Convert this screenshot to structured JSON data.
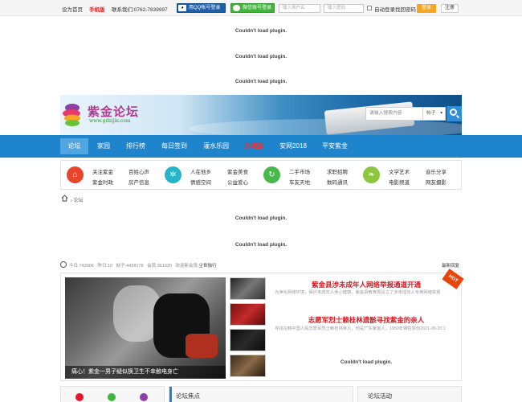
{
  "topbar": {
    "set_home": "设为首页",
    "mobile": "手机版",
    "contact": "联系我们:0762-7839997",
    "qq_login": "用QQ帐号登录",
    "wechat_login": "微信账号登录",
    "username_placeholder": "输入用户名",
    "password_placeholder": "输入密码",
    "auto_login": "自动登录",
    "forgot": "找回密码",
    "login": "登录",
    "register": "注册"
  },
  "plugin_message": "Couldn't load plugin.",
  "logo": {
    "name": "紫金论坛",
    "url": "www.gdzijin.com"
  },
  "search": {
    "placeholder": "请输入搜索内容",
    "scope": "帖子"
  },
  "nav": [
    "论坛",
    "家园",
    "排行榜",
    "每日签到",
    "灌水乐园",
    "手机版",
    "安网2018",
    "平安紫金"
  ],
  "categories": {
    "group1": [
      "关注紫金",
      "百姓心声",
      "紫金时政",
      "房产信息"
    ],
    "group2": [
      "人在他乡",
      "紫金美食",
      "情感空间",
      "公益爱心"
    ],
    "group3": [
      "二手市场",
      "求职招聘",
      "车友天地",
      "数码通讯"
    ],
    "group4": [
      "文学艺术",
      "音乐分享",
      "电影频道",
      "网友摄影"
    ]
  },
  "breadcrumb": {
    "separator": "›",
    "current": "论坛"
  },
  "stats": {
    "today_label": "今日:",
    "today": "743906",
    "yesterday_label": "昨日:",
    "yesterday": "10",
    "posts_label": "帖子:",
    "posts": "4438178",
    "members_label": "会员:",
    "members": "361020",
    "newest_label": "欢迎新会员:",
    "newest": "尘世独行"
  },
  "latest_reply": "最新回复",
  "slide_caption": "痛心！紫金一男子疑似换卫生不幸触电身亡",
  "hot_tag": "HOT",
  "headlines": [
    {
      "title": "紫金县涉未成年人网络举报通道开通",
      "summary": "为净化网络环境，保护未成年人身心健康，紫金县教育局设立了涉未成年人专用网络举报"
    },
    {
      "title": "志愿军烈士赖桂林遗骸寻找紫金的亲人",
      "summary": "寻找在韩中国人民志愿军烈士赖桂林亲人，他是广东紫金人，1950年牺牲原创2021-09-20 1"
    }
  ],
  "bottom": {
    "focus": "论坛焦点",
    "activity": "论坛活动"
  },
  "colors": {
    "nav_blue": "#1e84cc",
    "accent_red": "#d9161d",
    "login_orange": "#f5a623"
  }
}
